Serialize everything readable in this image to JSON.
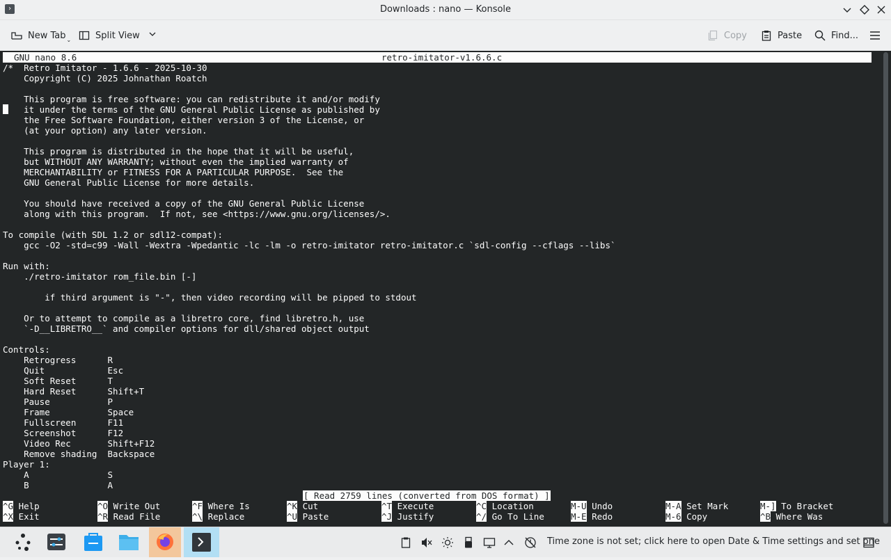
{
  "window": {
    "title": "Downloads : nano — Konsole",
    "app_icon_glyph": "›"
  },
  "toolbar": {
    "new_tab": "New Tab",
    "split_view": "Split View",
    "copy": "Copy",
    "paste": "Paste",
    "find": "Find..."
  },
  "nano": {
    "version": "GNU nano 8.6",
    "filename": "retro-imitator-v1.6.6.c",
    "status": "[ Read 2759 lines (converted from DOS format) ]",
    "lines": [
      "/*  Retro Imitator - 1.6.6 - 2025-10-30",
      "    Copyright (C) 2025 Johnathan Roatch",
      "",
      "    This program is free software: you can redistribute it and/or modify",
      "    it under the terms of the GNU General Public License as published by",
      "    the Free Software Foundation, either version 3 of the License, or",
      "    (at your option) any later version.",
      "",
      "    This program is distributed in the hope that it will be useful,",
      "    but WITHOUT ANY WARRANTY; without even the implied warranty of",
      "    MERCHANTABILITY or FITNESS FOR A PARTICULAR PURPOSE.  See the",
      "    GNU General Public License for more details.",
      "",
      "    You should have received a copy of the GNU General Public License",
      "    along with this program.  If not, see <https://www.gnu.org/licenses/>.",
      "",
      "To compile (with SDL 1.2 or sdl12-compat):",
      "    gcc -O2 -std=c99 -Wall -Wextra -Wpedantic -lc -lm -o retro-imitator retro-imitator.c `sdl-config --cflags --libs`",
      "",
      "Run with:",
      "    ./retro-imitator rom_file.bin [-]",
      "",
      "        if third argument is \"-\", then video recording will be pipped to stdout",
      "",
      "    Or to attempt to compile as a libretro core, find libretro.h, use",
      "    `-D__LIBRETRO__` and compiler options for dll/shared object output",
      "",
      "Controls:",
      "    Retrogress      R",
      "    Quit            Esc",
      "    Soft Reset      T",
      "    Hard Reset      Shift+T",
      "    Pause           P",
      "    Frame           Space",
      "    Fullscreen      F11",
      "    Screenshot      F12",
      "    Video Rec       Shift+F12",
      "    Remove shading  Backspace",
      "Player 1:",
      "    A               S",
      "    B               A"
    ],
    "shortcuts": [
      {
        "k1": "^G",
        "l1": "Help",
        "k2": "^X",
        "l2": "Exit"
      },
      {
        "k1": "^O",
        "l1": "Write Out",
        "k2": "^R",
        "l2": "Read File"
      },
      {
        "k1": "^F",
        "l1": "Where Is",
        "k2": "^\\",
        "l2": "Replace"
      },
      {
        "k1": "^K",
        "l1": "Cut",
        "k2": "^U",
        "l2": "Paste"
      },
      {
        "k1": "^T",
        "l1": "Execute",
        "k2": "^J",
        "l2": "Justify"
      },
      {
        "k1": "^C",
        "l1": "Location",
        "k2": "^/",
        "l2": "Go To Line"
      },
      {
        "k1": "M-U",
        "l1": "Undo",
        "k2": "M-E",
        "l2": "Redo"
      },
      {
        "k1": "M-A",
        "l1": "Set Mark",
        "k2": "M-6",
        "l2": "Copy"
      },
      {
        "k1": "M-]",
        "l1": "To Bracket",
        "k2": "^B",
        "l2": "Where Was"
      }
    ]
  },
  "taskbar": {
    "timezone_notice": "Time zone is not set; click here to open Date & Time settings and set one"
  },
  "colors": {
    "terminal_bg": "#232627",
    "terminal_fg": "#fcfcfc",
    "active_task": "#b2dff4"
  }
}
